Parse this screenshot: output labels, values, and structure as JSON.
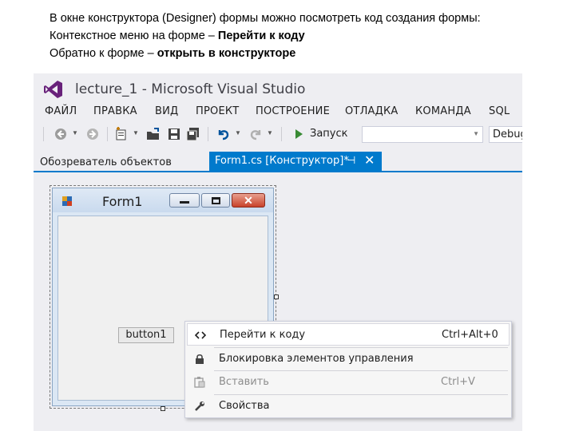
{
  "caption": {
    "line1": "В окне конструктора (Designer) формы можно посмотреть код создания формы:",
    "line2_prefix": "Контекстное меню на форме – ",
    "line2_bold": "Перейти к коду",
    "line3_prefix": "Обратно к форме – ",
    "line3_bold": "открыть в конструкторе"
  },
  "window": {
    "title": "lecture_1 - Microsoft Visual Studio",
    "accent": "#007acc"
  },
  "menu": [
    "ФАЙЛ",
    "ПРАВКА",
    "ВИД",
    "ПРОЕКТ",
    "ПОСТРОЕНИЕ",
    "ОТЛАДКА",
    "КОМАНДА",
    "SQL"
  ],
  "toolbar": {
    "run_label": "Запуск",
    "config_value": "Debug"
  },
  "tabs": {
    "object_browser": "Обозреватель объектов",
    "active": "Form1.cs [Конструктор]*"
  },
  "form": {
    "title": "Form1",
    "button_label": "button1"
  },
  "context_menu": [
    {
      "label": "Перейти к коду",
      "shortcut": "Ctrl+Alt+0",
      "icon": "code-icon",
      "enabled": true
    },
    {
      "label": "Блокировка элементов управления",
      "shortcut": "",
      "icon": "lock-icon",
      "enabled": true
    },
    {
      "label": "Вставить",
      "shortcut": "Ctrl+V",
      "icon": "paste-icon",
      "enabled": false
    },
    {
      "label": "Свойства",
      "shortcut": "",
      "icon": "wrench-icon",
      "enabled": true
    }
  ]
}
